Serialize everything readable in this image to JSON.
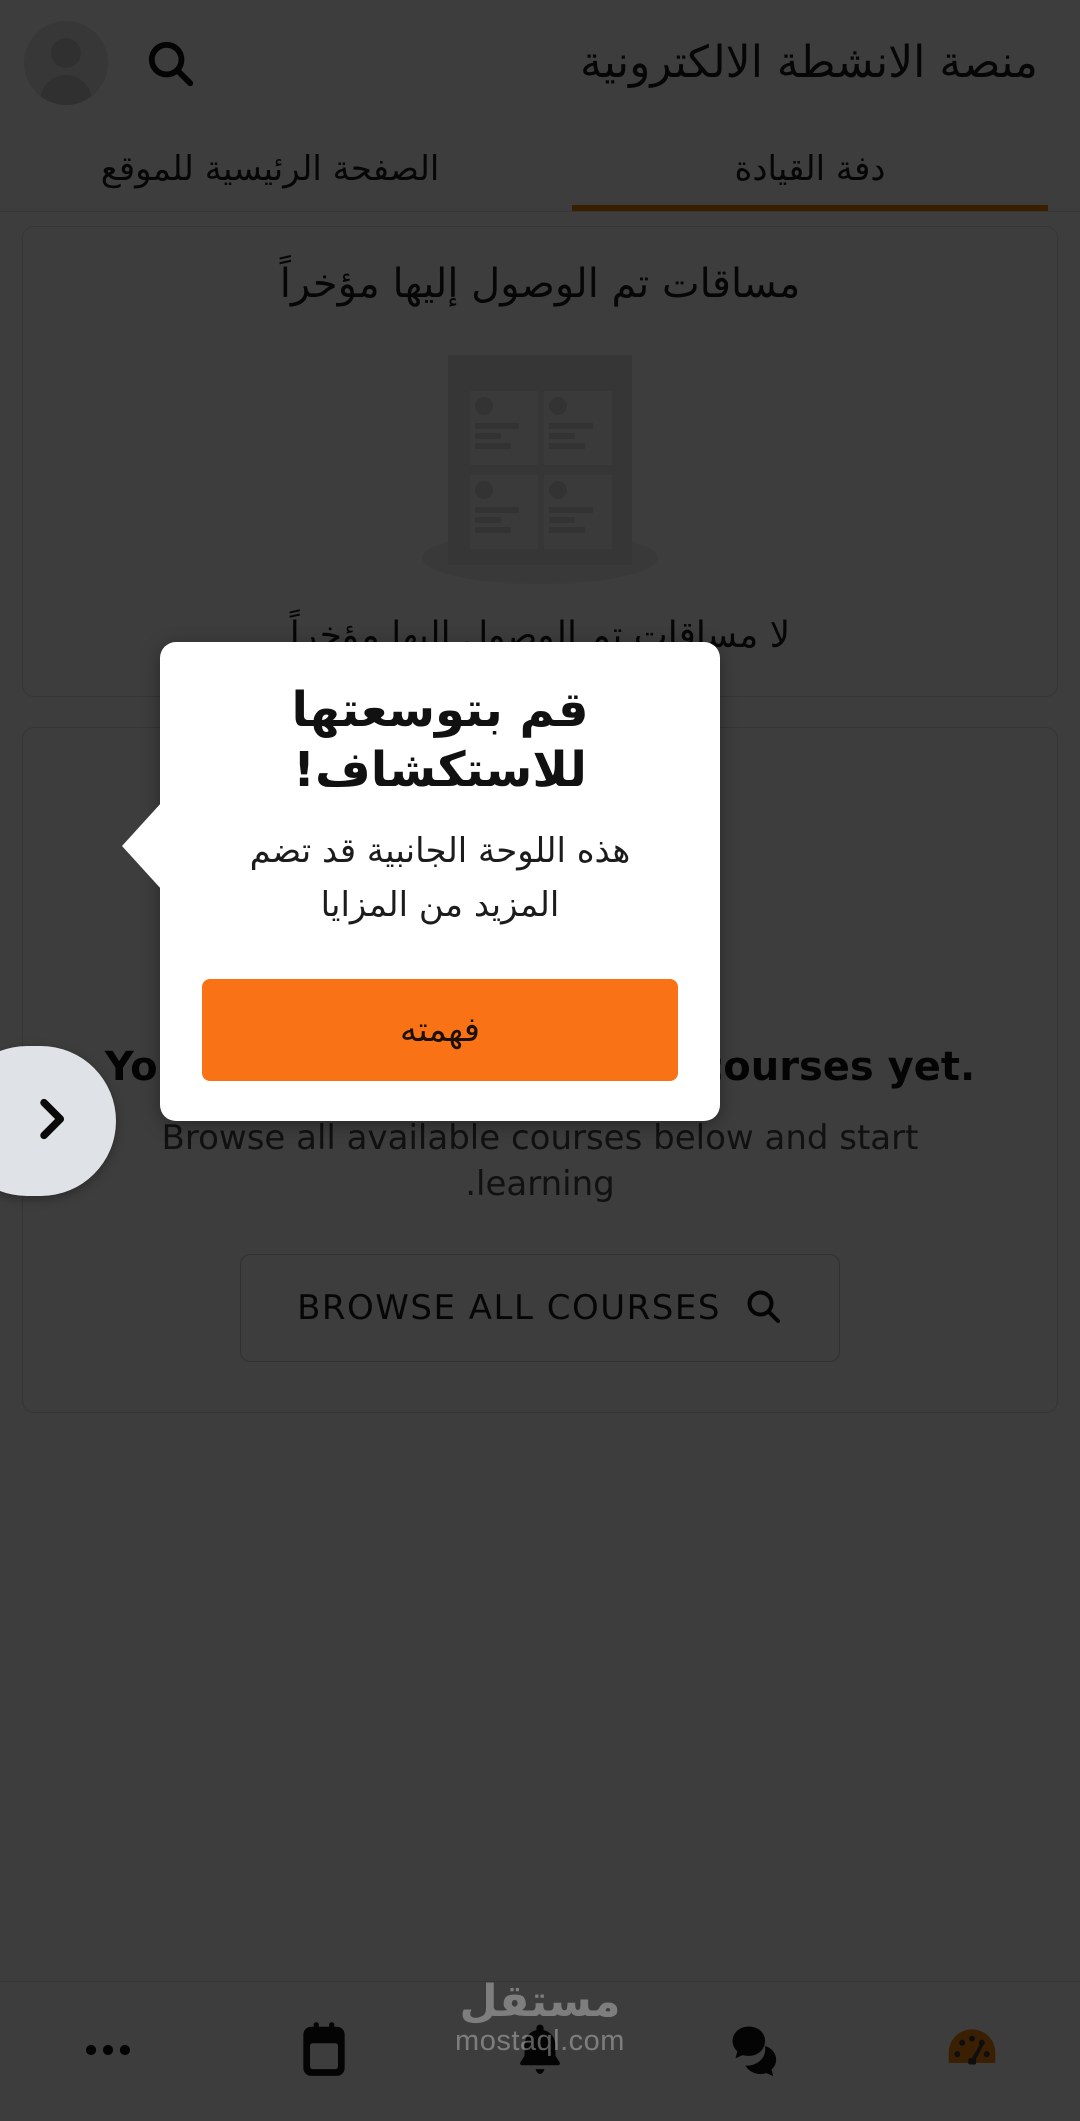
{
  "header": {
    "title": "منصة الانشطة الالكترونية",
    "search_icon": "search-icon",
    "avatar_label": "user-avatar"
  },
  "tabs": [
    {
      "label": "دفة القيادة",
      "active": true
    },
    {
      "label": "الصفحة الرئيسية للموقع",
      "active": false
    }
  ],
  "recent_card": {
    "title": "مساقات تم الوصول إليها مؤخراً",
    "empty_text": "لا مساقات تم الوصول إليها مؤخراً",
    "illustration": "courses-board-placeholder-illustration"
  },
  "courses_card": {
    "title_en": ".You're not enrolled in any courses yet",
    "subtitle_en": "Browse all available courses below and start\n.learning",
    "browse_button": "BROWSE ALL COURSES",
    "browse_icon": "search-icon",
    "illustration": "courses-board-placeholder-illustration"
  },
  "coach_mark": {
    "title": "قم بتوسعتها للاستكشاف!",
    "body": "هذه اللوحة الجانبية قد تضم المزيد من المزايا",
    "button_label": "فهمته",
    "button_color": "#f97316"
  },
  "pull_tab": {
    "icon": "chevron-right-icon",
    "background": "#dfe3e8"
  },
  "bottom_nav": [
    {
      "icon": "more-horizontal-icon",
      "label": "more"
    },
    {
      "icon": "calendar-icon",
      "label": "calendar"
    },
    {
      "icon": "bell-icon",
      "label": "notifications"
    },
    {
      "icon": "chat-bubbles-icon",
      "label": "messages"
    },
    {
      "icon": "gauge-dashboard-icon",
      "label": "dashboard",
      "color": "#c2540f"
    }
  ],
  "watermark": {
    "arabic": "مستقل",
    "domain": "mostaql.com"
  },
  "theme": {
    "accent": "#f97316",
    "tab_underline": "#f77f00",
    "overlay": "rgba(0,0,0,0.76)"
  }
}
